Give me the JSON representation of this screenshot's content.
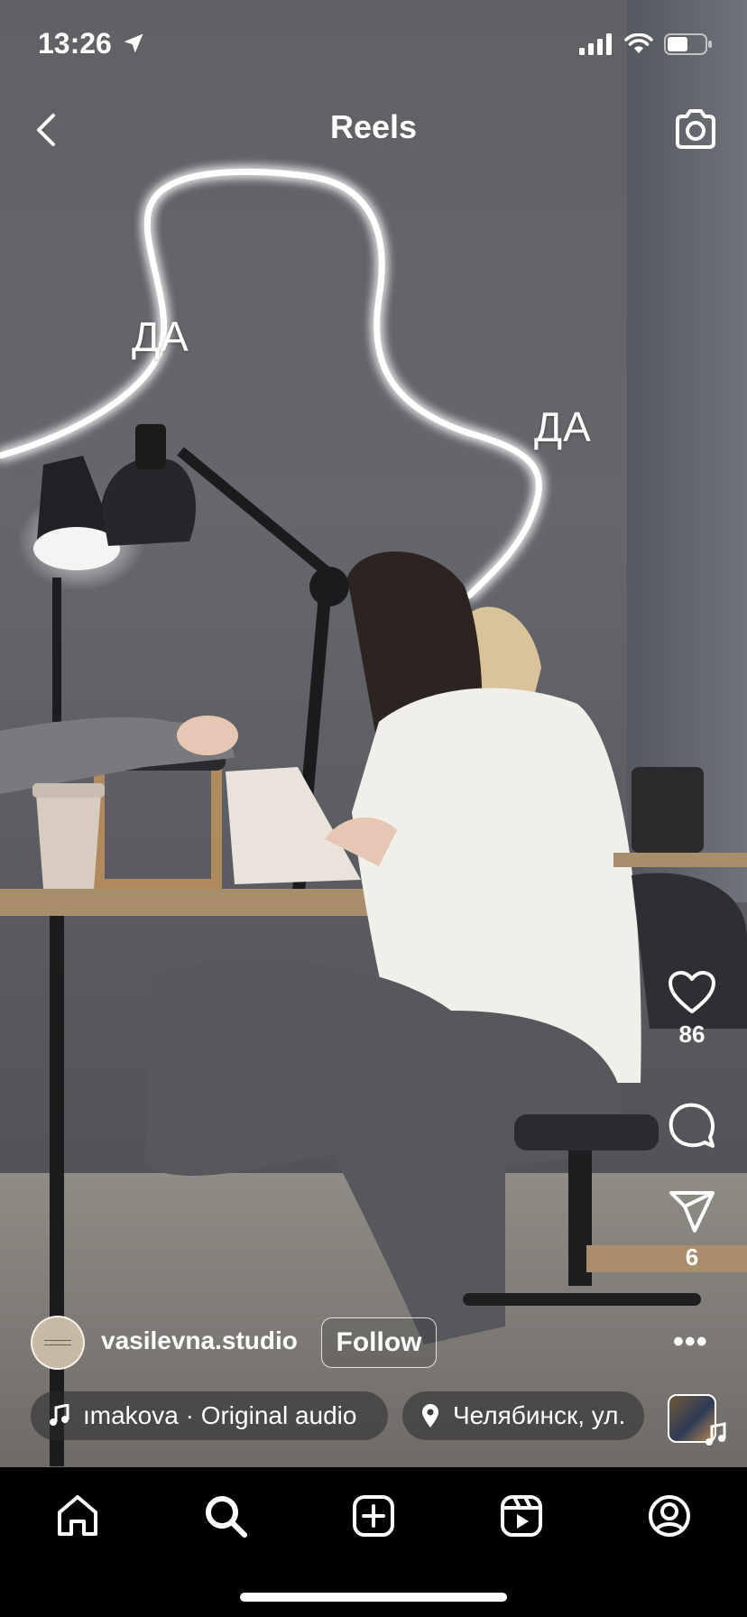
{
  "status_bar": {
    "time": "13:26"
  },
  "header": {
    "title": "Reels"
  },
  "video": {
    "overlay_texts": [
      "ДА",
      "ДА"
    ]
  },
  "actions": {
    "likes": "86",
    "shares": "6"
  },
  "account": {
    "username": "vasilevna.studio",
    "follow_label": "Follow",
    "avatar_label": "VASILEVNA STUDIO"
  },
  "audio": {
    "label": "ımakova · Original audio"
  },
  "location": {
    "label": "Челябинск, ул."
  },
  "nav": {
    "items": [
      "home-icon",
      "search-icon",
      "create-icon",
      "reels-icon",
      "profile-icon"
    ]
  },
  "colors": {
    "nav_background": "#000000",
    "text": "#ffffff"
  }
}
